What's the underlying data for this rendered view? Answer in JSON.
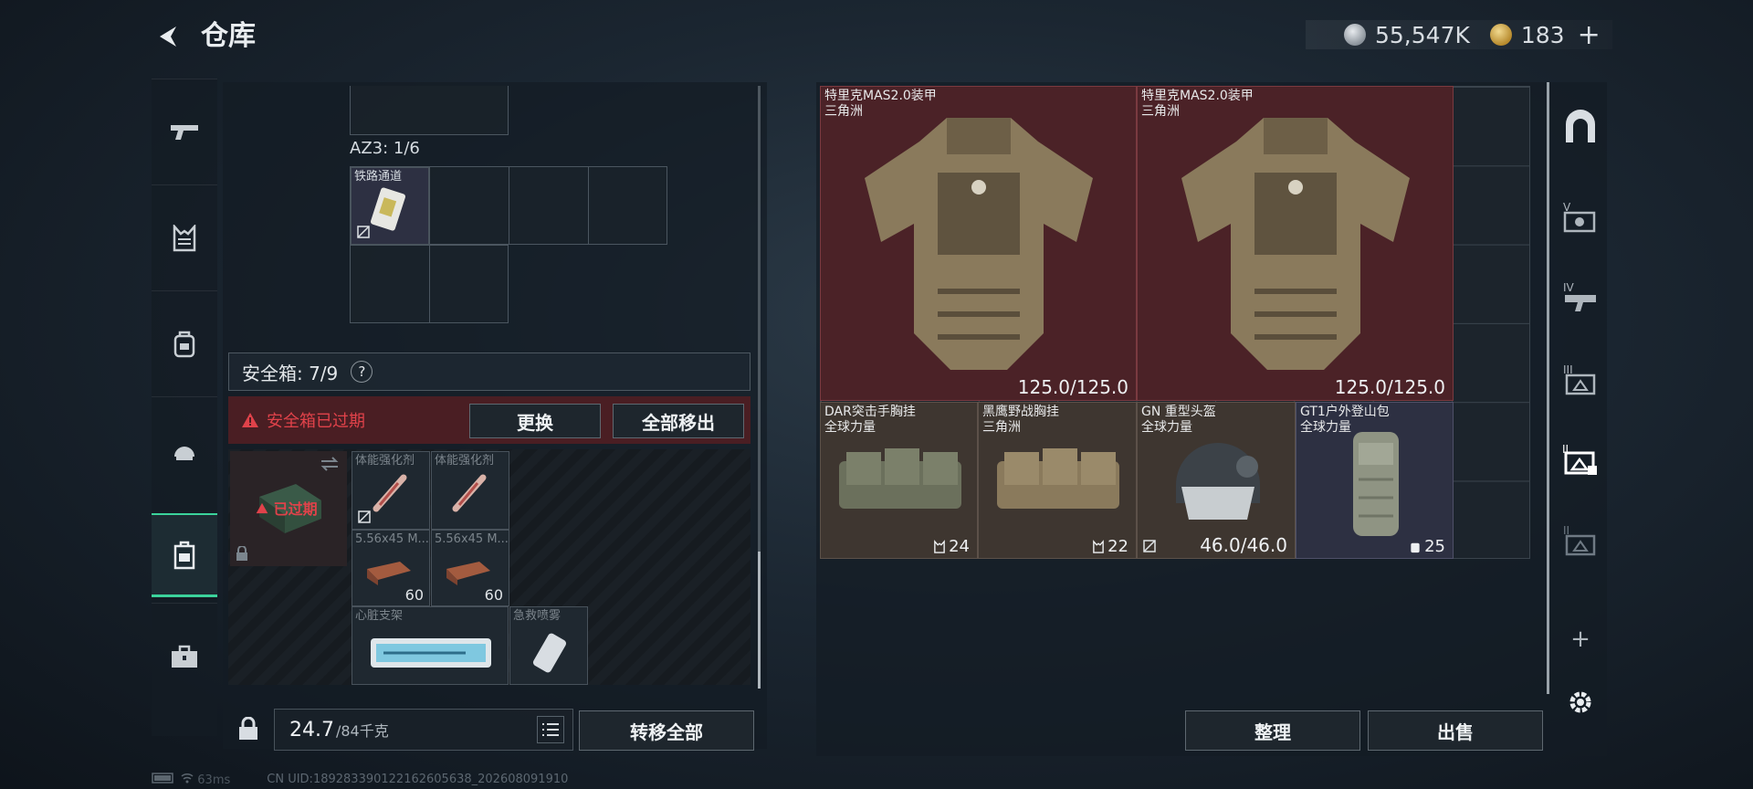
{
  "header": {
    "title": "仓库",
    "currency1": "55,547K",
    "currency2": "183",
    "plus": "+"
  },
  "left_nav": {
    "items": [
      {
        "icon": "gun-icon"
      },
      {
        "icon": "vest-icon"
      },
      {
        "icon": "backpack-icon"
      },
      {
        "icon": "helmet-icon"
      },
      {
        "icon": "safebox-icon",
        "active": true
      },
      {
        "icon": "toolbox-icon"
      }
    ]
  },
  "storage": {
    "az3_label": "AZ3: 1/6",
    "az3_item_name": "铁路通道"
  },
  "safebox": {
    "label": "安全箱: 7/9",
    "help": "?",
    "warning": "安全箱已过期",
    "replace_button": "更换",
    "remove_all_button": "全部移出",
    "expired_label": "已过期",
    "items": [
      {
        "name": "体能强化剂"
      },
      {
        "name": "体能强化剂"
      },
      {
        "name": "5.56x45 M...",
        "qty": "60"
      },
      {
        "name": "5.56x45 M...",
        "qty": "60"
      },
      {
        "name": "心脏支架"
      },
      {
        "name": "急救喷雾"
      }
    ]
  },
  "footer_left": {
    "weight": "24.7",
    "weight_max": "/84千克",
    "transfer_all_button": "转移全部"
  },
  "inventory": {
    "items": [
      {
        "name": "特里克MAS2.0装甲",
        "sub": "三角洲",
        "durability": "125.0/125.0"
      },
      {
        "name": "特里克MAS2.0装甲",
        "sub": "三角洲",
        "durability": "125.0/125.0"
      },
      {
        "name": "DAR突击手胸挂",
        "sub": "全球力量",
        "count": "24"
      },
      {
        "name": "黑鹰野战胸挂",
        "sub": "三角洲",
        "count": "22"
      },
      {
        "name": "GN 重型头盔",
        "sub": "全球力量",
        "durability": "46.0/46.0"
      },
      {
        "name": "GT1户外登山包",
        "sub": "全球力量",
        "count": "25"
      }
    ],
    "sort_button": "整理",
    "sell_button": "出售"
  },
  "right_nav": {
    "add": "+"
  },
  "status": {
    "ping": "63ms",
    "uid": "CN UID:1892833901221626056​38_202608091910"
  },
  "colors": {
    "accent": "#3bd39b",
    "warning": "#e0424a",
    "red_slot": "#4b2227"
  }
}
